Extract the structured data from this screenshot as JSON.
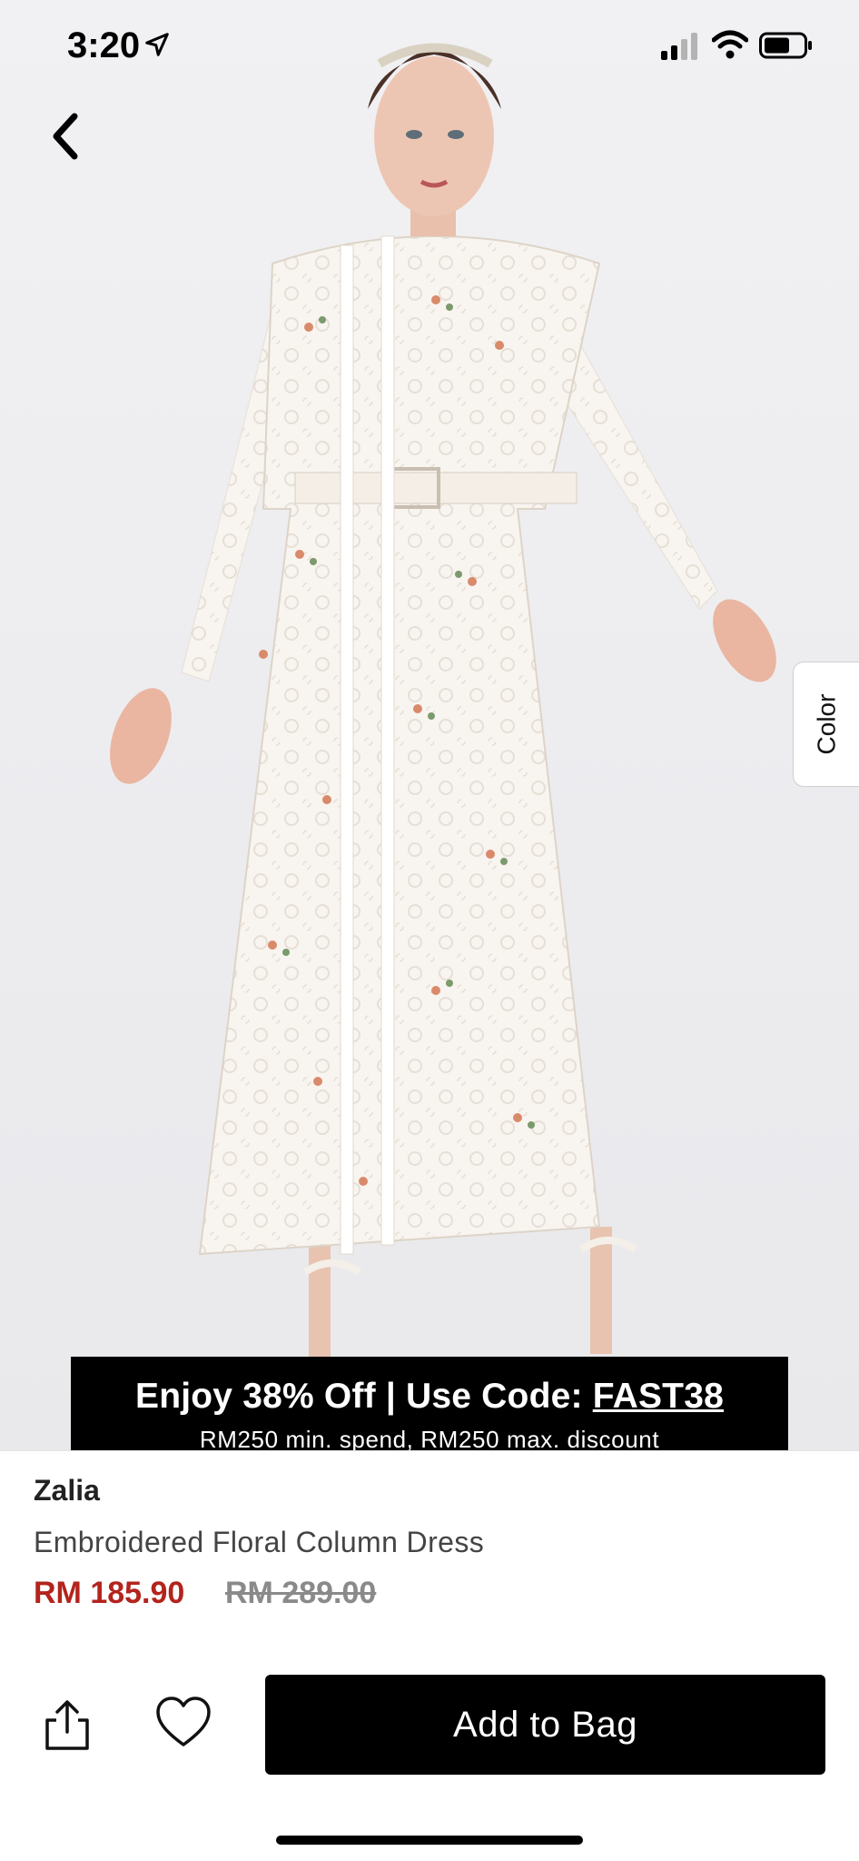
{
  "status_bar": {
    "time": "3:20"
  },
  "product_image": {
    "alt": "model-in-embroidered-white-dress"
  },
  "side_tab": {
    "label": "Color"
  },
  "promo_banner": {
    "prefix": "Enjoy 38% Off | Use Code: ",
    "code": "FAST38",
    "subtext": "RM250 min. spend, RM250 max. discount"
  },
  "product": {
    "brand": "Zalia",
    "name": "Embroidered Floral Column Dress",
    "price": "RM 185.90",
    "original_price": "RM 289.00"
  },
  "actions": {
    "add_to_bag_label": "Add to Bag"
  },
  "colors": {
    "sale_price": "#b3241d",
    "button": "#000000"
  }
}
